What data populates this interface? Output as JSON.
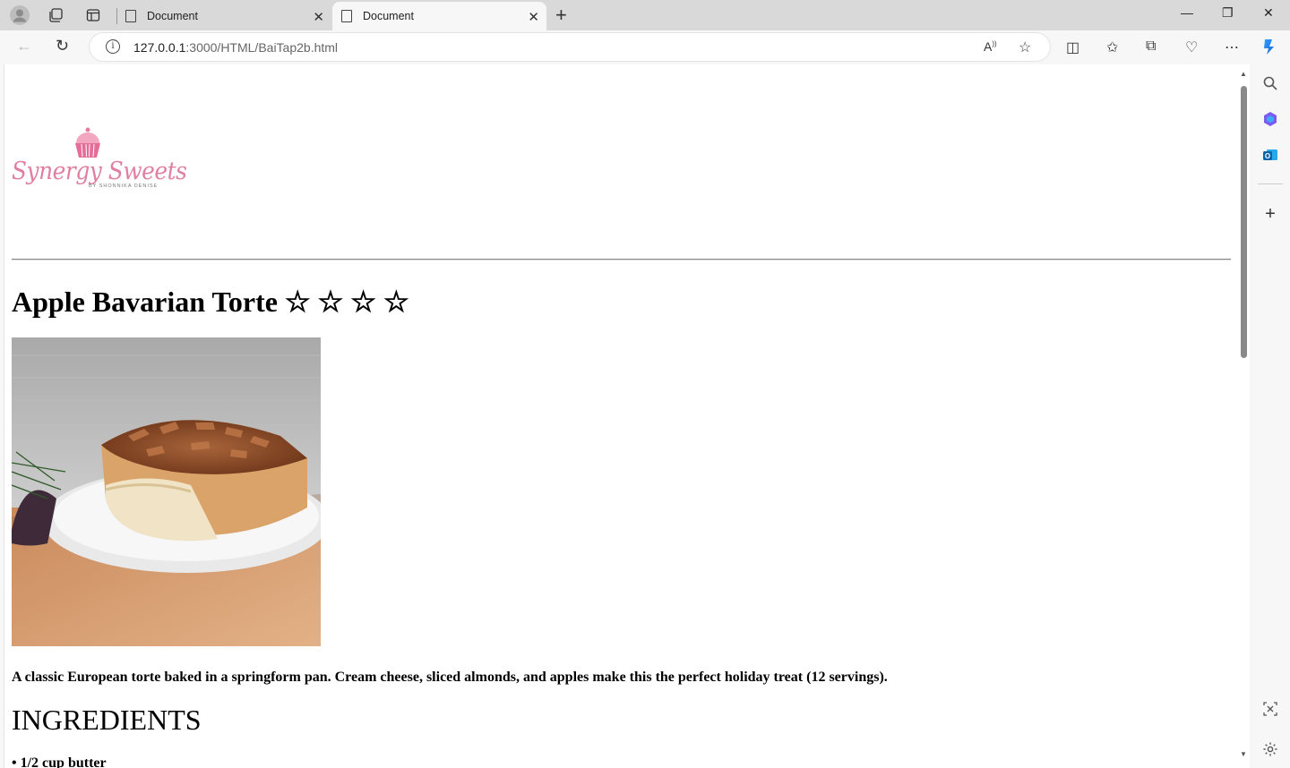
{
  "browser": {
    "tabs": [
      {
        "title": "Document"
      },
      {
        "title": "Document"
      }
    ],
    "url_host": "127.0.0.1",
    "url_rest": ":3000/HTML/BaiTap2b.html"
  },
  "page": {
    "logo_text": "Synergy Sweets",
    "logo_subtext": "BY SHONNIKA DENISE",
    "title": "Apple Bavarian Torte ☆ ☆ ☆ ☆",
    "description": "A classic European torte baked in a springform pan. Cream cheese, sliced almonds, and apples make this the perfect holiday treat (12 servings).",
    "ingredients_heading": "INGREDIENTS",
    "ingredients": [
      "• 1/2 cup butter"
    ]
  },
  "colors": {
    "logo_pink": "#e07f9f",
    "tabbar": "#d9d9d9"
  }
}
